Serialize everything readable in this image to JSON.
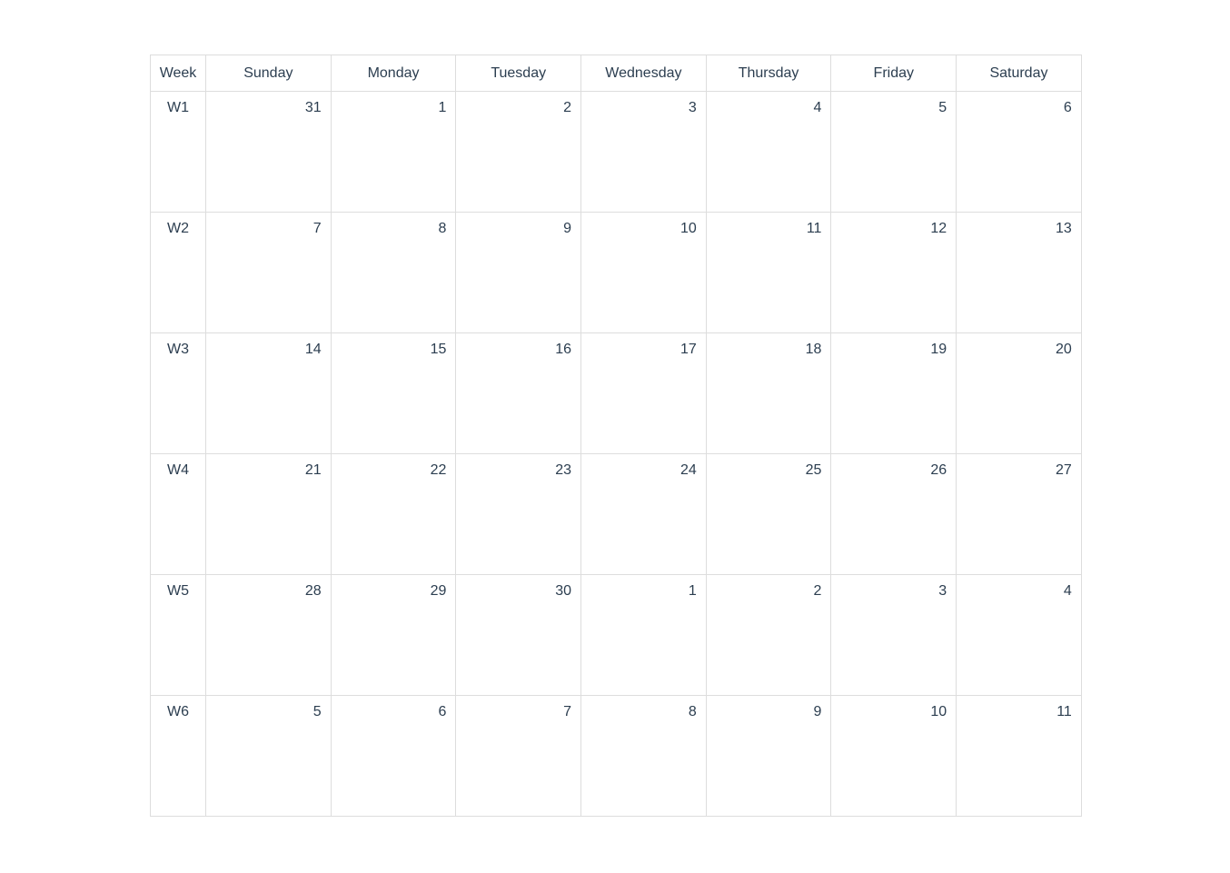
{
  "header": {
    "week_label": "Week",
    "days": [
      "Sunday",
      "Monday",
      "Tuesday",
      "Wednesday",
      "Thursday",
      "Friday",
      "Saturday"
    ]
  },
  "weeks": [
    {
      "label": "W1",
      "dates": [
        "31",
        "1",
        "2",
        "3",
        "4",
        "5",
        "6"
      ]
    },
    {
      "label": "W2",
      "dates": [
        "7",
        "8",
        "9",
        "10",
        "11",
        "12",
        "13"
      ]
    },
    {
      "label": "W3",
      "dates": [
        "14",
        "15",
        "16",
        "17",
        "18",
        "19",
        "20"
      ]
    },
    {
      "label": "W4",
      "dates": [
        "21",
        "22",
        "23",
        "24",
        "25",
        "26",
        "27"
      ]
    },
    {
      "label": "W5",
      "dates": [
        "28",
        "29",
        "30",
        "1",
        "2",
        "3",
        "4"
      ]
    },
    {
      "label": "W6",
      "dates": [
        "5",
        "6",
        "7",
        "8",
        "9",
        "10",
        "11"
      ]
    }
  ],
  "colors": {
    "text": "#2c3e50",
    "grid_border": "#dddddd",
    "background": "#ffffff"
  }
}
